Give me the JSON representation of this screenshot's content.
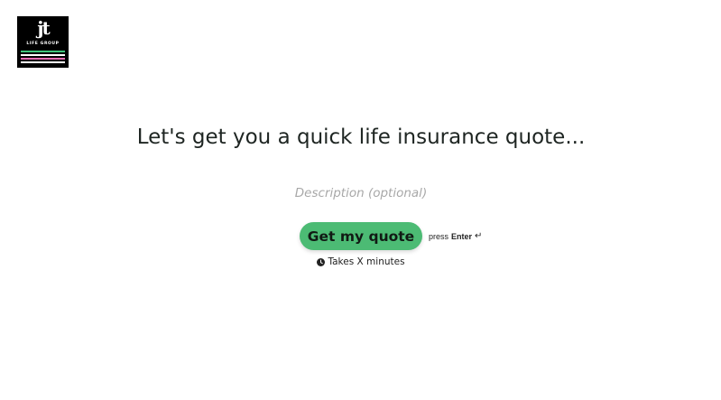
{
  "brand": {
    "logo_mark": "jt",
    "logo_subtitle": "LIFE GROUP",
    "stripe_colors": [
      "#3ec27a",
      "#ffffff",
      "#e56ab3",
      "#ffffff"
    ]
  },
  "main": {
    "headline": "Let's get you a quick life insurance quote...",
    "description_placeholder": "Description (optional)",
    "cta_label": "Get my quote",
    "hint_prefix": "press",
    "hint_key": "Enter",
    "hint_icon": "↵",
    "duration_icon": "clock-icon",
    "duration_text": "Takes X minutes"
  },
  "colors": {
    "accent": "#4cbb74",
    "text": "#1e2522",
    "placeholder": "#a8a8a8"
  }
}
